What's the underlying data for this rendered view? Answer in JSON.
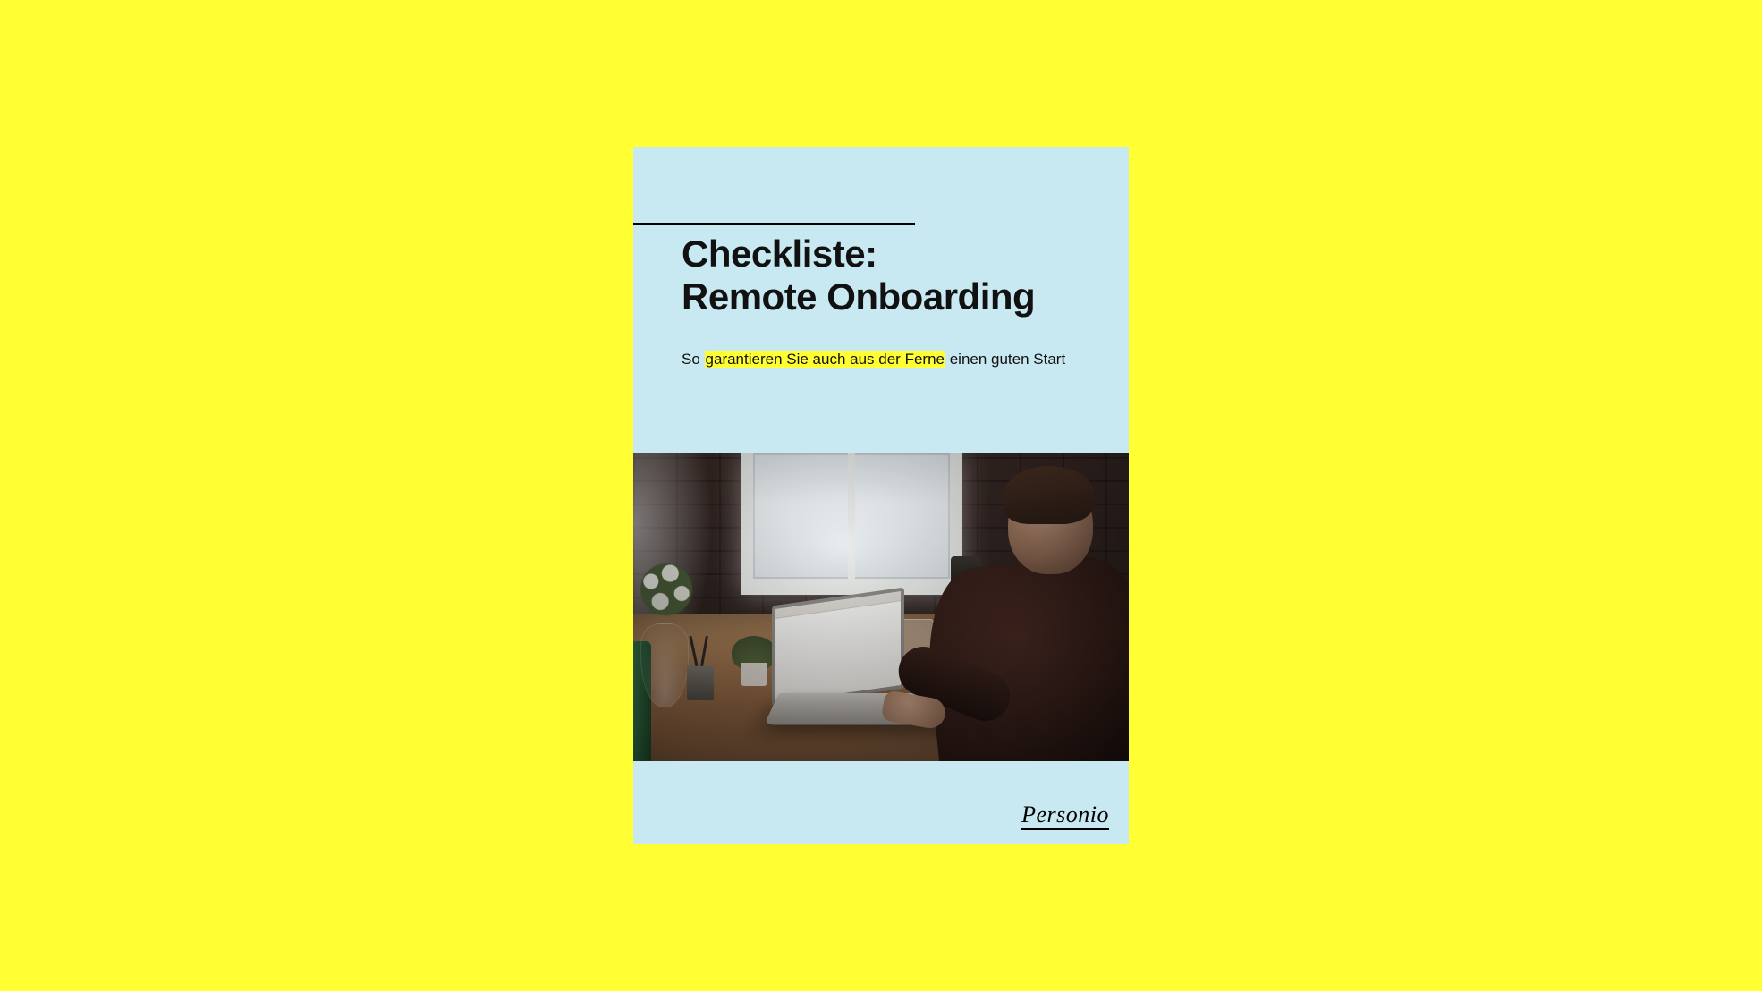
{
  "document": {
    "title_line1": "Checkliste:",
    "title_line2": "Remote Onboarding",
    "subtitle_prefix": "So ",
    "subtitle_highlight": "garantieren Sie auch aus der Ferne",
    "subtitle_suffix": " einen guten Start"
  },
  "brand": {
    "logo_text": "Personio"
  },
  "colors": {
    "page_bg": "#ffff33",
    "card_bg": "#c9e9f2",
    "highlight": "#ffff33"
  }
}
